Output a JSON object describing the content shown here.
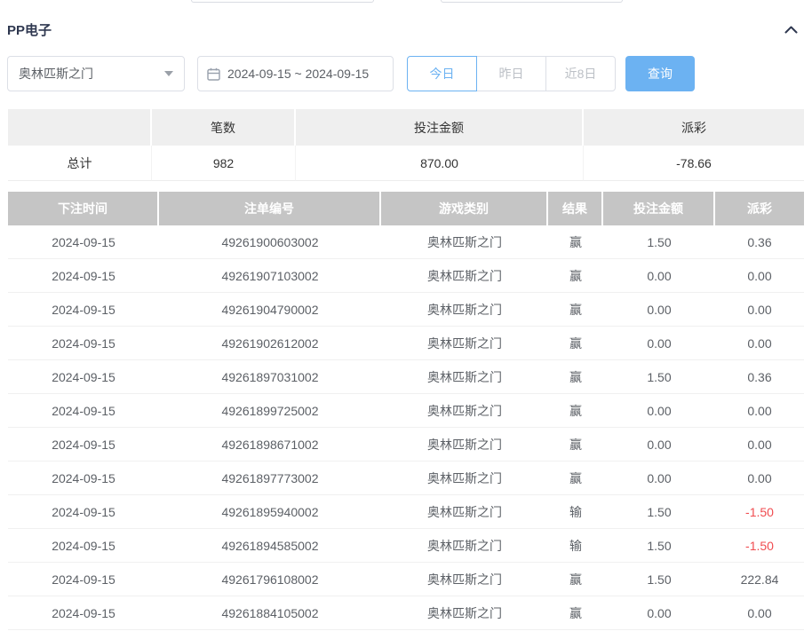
{
  "colors": {
    "accent": "#6cb2f2",
    "negative": "#f04c50",
    "table_header_bg": "#c5c5c5",
    "summary_header_bg": "#efefef"
  },
  "header": {
    "title": "PP电子",
    "collapse_icon": "chevron-up-icon"
  },
  "filters": {
    "game_select": {
      "value": "奥林匹斯之门",
      "caret_icon": "chevron-down-icon"
    },
    "date_range": {
      "value": "2024-09-15 ~ 2024-09-15",
      "icon": "calendar-icon"
    },
    "quick_buttons": [
      {
        "label": "今日",
        "active": true
      },
      {
        "label": "昨日",
        "active": false
      },
      {
        "label": "近8日",
        "active": false
      }
    ],
    "search_label": "查询"
  },
  "summary": {
    "headers": [
      "",
      "笔数",
      "投注金额",
      "派彩"
    ],
    "row": {
      "label": "总计",
      "count": "982",
      "bet_amount": "870.00",
      "payout": "-78.66"
    }
  },
  "table": {
    "headers": [
      "下注时间",
      "注单编号",
      "游戏类别",
      "结果",
      "投注金额",
      "派彩"
    ],
    "rows": [
      {
        "time": "2024-09-15",
        "order_id": "49261900603002",
        "game": "奥林匹斯之门",
        "result": "赢",
        "bet": "1.50",
        "payout": "0.36"
      },
      {
        "time": "2024-09-15",
        "order_id": "49261907103002",
        "game": "奥林匹斯之门",
        "result": "赢",
        "bet": "0.00",
        "payout": "0.00"
      },
      {
        "time": "2024-09-15",
        "order_id": "49261904790002",
        "game": "奥林匹斯之门",
        "result": "赢",
        "bet": "0.00",
        "payout": "0.00"
      },
      {
        "time": "2024-09-15",
        "order_id": "49261902612002",
        "game": "奥林匹斯之门",
        "result": "赢",
        "bet": "0.00",
        "payout": "0.00"
      },
      {
        "time": "2024-09-15",
        "order_id": "49261897031002",
        "game": "奥林匹斯之门",
        "result": "赢",
        "bet": "1.50",
        "payout": "0.36"
      },
      {
        "time": "2024-09-15",
        "order_id": "49261899725002",
        "game": "奥林匹斯之门",
        "result": "赢",
        "bet": "0.00",
        "payout": "0.00"
      },
      {
        "time": "2024-09-15",
        "order_id": "49261898671002",
        "game": "奥林匹斯之门",
        "result": "赢",
        "bet": "0.00",
        "payout": "0.00"
      },
      {
        "time": "2024-09-15",
        "order_id": "49261897773002",
        "game": "奥林匹斯之门",
        "result": "赢",
        "bet": "0.00",
        "payout": "0.00"
      },
      {
        "time": "2024-09-15",
        "order_id": "49261895940002",
        "game": "奥林匹斯之门",
        "result": "输",
        "bet": "1.50",
        "payout": "-1.50"
      },
      {
        "time": "2024-09-15",
        "order_id": "49261894585002",
        "game": "奥林匹斯之门",
        "result": "输",
        "bet": "1.50",
        "payout": "-1.50"
      },
      {
        "time": "2024-09-15",
        "order_id": "49261796108002",
        "game": "奥林匹斯之门",
        "result": "赢",
        "bet": "1.50",
        "payout": "222.84"
      },
      {
        "time": "2024-09-15",
        "order_id": "49261884105002",
        "game": "奥林匹斯之门",
        "result": "赢",
        "bet": "0.00",
        "payout": "0.00"
      }
    ]
  }
}
